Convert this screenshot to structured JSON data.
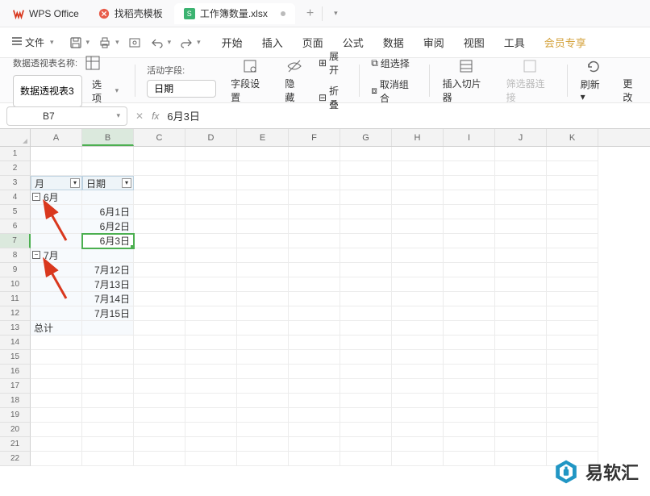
{
  "titlebar": {
    "app_name": "WPS Office",
    "template_tab": "找稻壳模板",
    "doc_name": "工作簿数量.xlsx",
    "doc_badge": "S"
  },
  "menubar": {
    "file": "文件",
    "items": [
      "开始",
      "插入",
      "页面",
      "公式",
      "数据",
      "审阅",
      "视图",
      "工具"
    ],
    "vip": "会员专享"
  },
  "ribbon": {
    "pivot_name_label": "数据透视表名称:",
    "pivot_name_value": "数据透视表3",
    "options": "选项",
    "active_field_label": "活动字段:",
    "active_field_value": "日期",
    "field_settings": "字段设置",
    "hide": "隐藏",
    "expand": "展开",
    "collapse": "折叠",
    "group_sel": "组选择",
    "ungroup": "取消组合",
    "slicer": "插入切片器",
    "filter_conn": "筛选器连接",
    "refresh": "刷新",
    "change": "更改"
  },
  "refbar": {
    "name": "B7",
    "fx": "fx",
    "value": "6月3日"
  },
  "sheet": {
    "columns": [
      "A",
      "B",
      "C",
      "D",
      "E",
      "F",
      "G",
      "H",
      "I",
      "J",
      "K"
    ],
    "selected_col": 1,
    "selected_row_idx": 6,
    "rows": [
      1,
      2,
      3,
      4,
      5,
      6,
      7,
      8,
      9,
      10,
      11,
      12,
      13,
      14,
      15,
      16,
      17,
      18,
      19,
      20,
      21,
      22
    ],
    "cells": {
      "A3": "月",
      "B3": "日期",
      "A4": "6月",
      "B5": "6月1日",
      "B6": "6月2日",
      "B7": "6月3日",
      "A8": "7月",
      "B9": "7月12日",
      "B10": "7月13日",
      "B11": "7月14日",
      "B12": "7月15日",
      "A13": "总计"
    }
  },
  "watermark": "易软汇",
  "chart_data": {
    "type": "table",
    "title": "",
    "columns": [
      "月",
      "日期"
    ],
    "groups": [
      {
        "month": "6月",
        "dates": [
          "6月1日",
          "6月2日",
          "6月3日"
        ]
      },
      {
        "month": "7月",
        "dates": [
          "7月12日",
          "7月13日",
          "7月14日",
          "7月15日"
        ]
      }
    ],
    "total_label": "总计"
  }
}
